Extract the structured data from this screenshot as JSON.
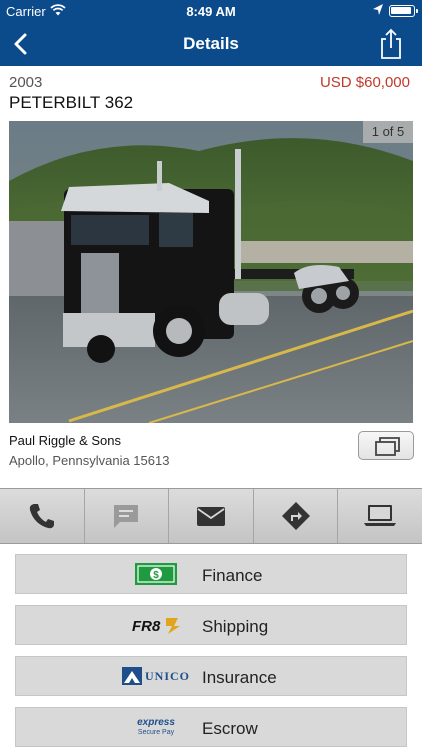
{
  "status": {
    "carrier": "Carrier",
    "time": "8:49 AM"
  },
  "nav": {
    "title": "Details"
  },
  "listing": {
    "year": "2003",
    "price": "USD $60,000",
    "model": "PETERBILT 362",
    "photo_counter": "1 of 5",
    "seller": "Paul Riggle & Sons",
    "location": "Apollo, Pennsylvania 15613"
  },
  "actions": [
    {
      "icon": "phone-icon",
      "enabled": true
    },
    {
      "icon": "message-icon",
      "enabled": false
    },
    {
      "icon": "mail-icon",
      "enabled": true
    },
    {
      "icon": "directions-icon",
      "enabled": true
    },
    {
      "icon": "laptop-icon",
      "enabled": true
    }
  ],
  "services": [
    {
      "label": "Finance",
      "logo": "finance-logo"
    },
    {
      "label": "Shipping",
      "logo": "fr8-logo"
    },
    {
      "label": "Insurance",
      "logo": "unico-logo",
      "logo_text": "UNICO"
    },
    {
      "label": "Escrow",
      "logo": "express-secure-pay-logo",
      "logo_text": "express",
      "logo_subtext": "Secure Pay"
    }
  ],
  "colors": {
    "navbar": "#0b4a8b",
    "price": "#c0392b",
    "finance_green": "#1f9a3e",
    "fr8_gold": "#e1a51d"
  }
}
